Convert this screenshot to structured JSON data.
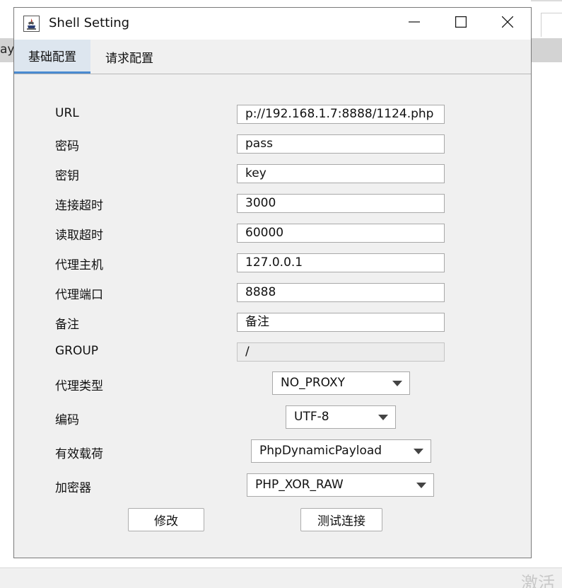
{
  "window": {
    "title": "Shell Setting"
  },
  "tabs": [
    {
      "label": "基础配置",
      "active": true
    },
    {
      "label": "请求配置",
      "active": false
    }
  ],
  "form": {
    "url": {
      "label": "URL",
      "value": "p://192.168.1.7:8888/1124.php"
    },
    "password": {
      "label": "密码",
      "value": "pass"
    },
    "secret_key": {
      "label": "密钥",
      "value": "key"
    },
    "connect_timeout": {
      "label": "连接超时",
      "value": "3000"
    },
    "read_timeout": {
      "label": "读取超时",
      "value": "60000"
    },
    "proxy_host": {
      "label": "代理主机",
      "value": "127.0.0.1"
    },
    "proxy_port": {
      "label": "代理端口",
      "value": "8888"
    },
    "remark": {
      "label": "备注",
      "value": "备注"
    },
    "group": {
      "label": "GROUP",
      "value": "/"
    },
    "proxy_type": {
      "label": "代理类型",
      "selected": "NO_PROXY"
    },
    "encoding": {
      "label": "编码",
      "selected": "UTF-8"
    },
    "payload": {
      "label": "有效载荷",
      "selected": "PhpDynamicPayload"
    },
    "cryption": {
      "label": "加密器",
      "selected": "PHP_XOR_RAW"
    }
  },
  "buttons": {
    "modify": "修改",
    "test_connection": "测试连接"
  },
  "background": {
    "left_fragment": "ayl",
    "watermark": "激活"
  },
  "icons": {
    "app": "java-app-icon",
    "minimize": "minimize-icon",
    "maximize": "maximize-icon",
    "close": "close-icon",
    "dropdown": "chevron-down-icon"
  },
  "colors": {
    "active_tab_underline": "#4a8ad0",
    "active_tab_bg": "#dde6ef",
    "dialog_bg": "#f0f0f0"
  }
}
